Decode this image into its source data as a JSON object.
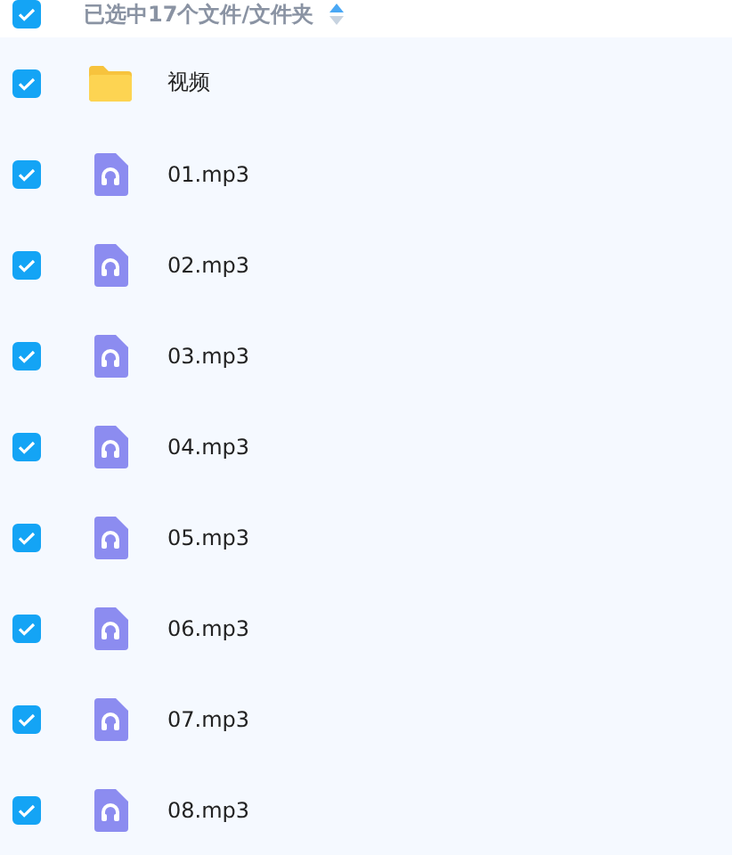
{
  "header": {
    "checked": true,
    "label": "已选中17个文件/文件夹"
  },
  "files": [
    {
      "kind": "folder",
      "name": "视频",
      "checked": true
    },
    {
      "kind": "audio",
      "name": "01.mp3",
      "checked": true
    },
    {
      "kind": "audio",
      "name": "02.mp3",
      "checked": true
    },
    {
      "kind": "audio",
      "name": "03.mp3",
      "checked": true
    },
    {
      "kind": "audio",
      "name": "04.mp3",
      "checked": true
    },
    {
      "kind": "audio",
      "name": "05.mp3",
      "checked": true
    },
    {
      "kind": "audio",
      "name": "06.mp3",
      "checked": true
    },
    {
      "kind": "audio",
      "name": "07.mp3",
      "checked": true
    },
    {
      "kind": "audio",
      "name": "08.mp3",
      "checked": true
    }
  ]
}
